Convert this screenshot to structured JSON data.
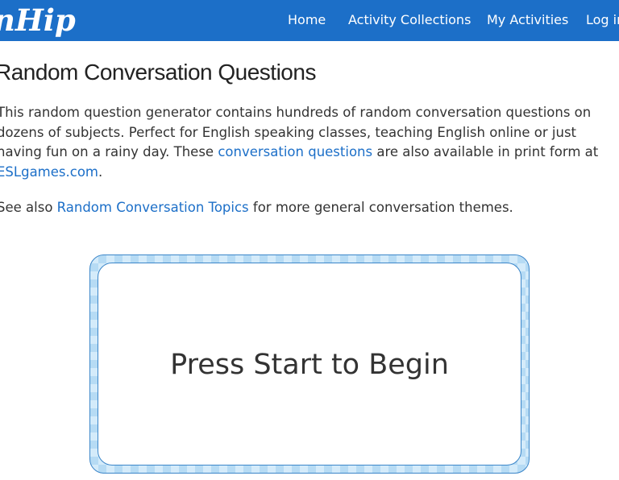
{
  "navbar": {
    "brand": "nHip",
    "links": [
      "Home",
      "Activity Collections",
      "My Activities",
      "Log in"
    ],
    "background_color": "#1c6fc8"
  },
  "page": {
    "title": "Random Conversation Questions",
    "intro_text_1": "This random question generator contains hundreds of random conversation questions on dozens of subjects. Perfect for English speaking classes, teaching English online or just having fun on a rainy day. These ",
    "intro_link_1": "conversation questions",
    "intro_text_2": " are also available in print form at ",
    "intro_link_2": "ESLgames.com",
    "intro_text_3": ".",
    "see_also_prefix": "See also ",
    "see_also_link": "Random Conversation Topics",
    "see_also_suffix": " for more general conversation themes.",
    "link_color": "#1c6fc8"
  },
  "card": {
    "text": "Press Start to Begin",
    "border_color": "#3b86c9",
    "pattern_colors": [
      "#d4ebfa",
      "#b6dbf4"
    ]
  }
}
